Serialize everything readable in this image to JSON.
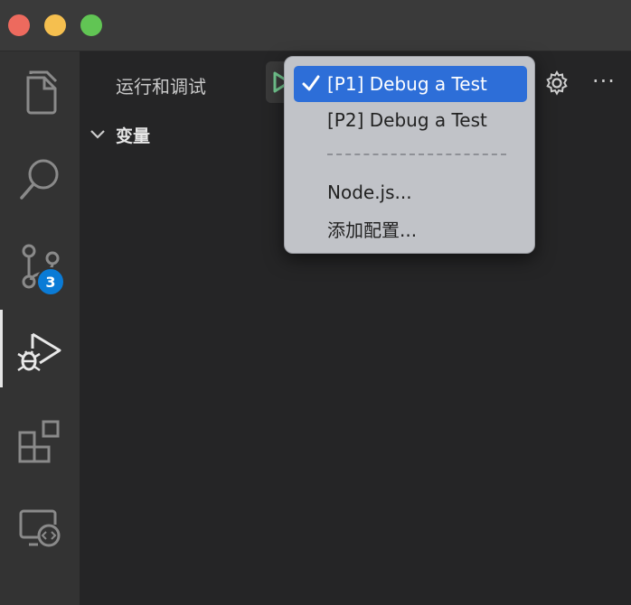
{
  "window": {
    "traffic_lights": [
      "close",
      "minimize",
      "zoom"
    ]
  },
  "activity_bar": {
    "items": [
      {
        "name": "explorer",
        "icon": "files-icon"
      },
      {
        "name": "search",
        "icon": "search-icon"
      },
      {
        "name": "source-control",
        "icon": "source-control-icon",
        "badge": "3"
      },
      {
        "name": "run-and-debug",
        "icon": "run-debug-icon",
        "active": true
      },
      {
        "name": "extensions",
        "icon": "extensions-icon"
      },
      {
        "name": "remote-explorer",
        "icon": "remote-explorer-icon"
      }
    ]
  },
  "sidebar": {
    "title": "运行和调试",
    "section": {
      "label": "变量",
      "expanded": true
    },
    "toolbar": {
      "run_icon": "play-icon",
      "gear_icon": "gear-icon",
      "more_label": "···"
    }
  },
  "dropdown": {
    "items": [
      {
        "label": "[P1] Debug a Test",
        "selected": true
      },
      {
        "label": "[P2] Debug a Test",
        "selected": false
      },
      {
        "label": "Node.js...",
        "selected": false
      },
      {
        "label": "添加配置...",
        "selected": false
      }
    ]
  },
  "colors": {
    "accent": "#2d6ed8",
    "badge": "#0a7bd6",
    "play": "#73c991"
  }
}
